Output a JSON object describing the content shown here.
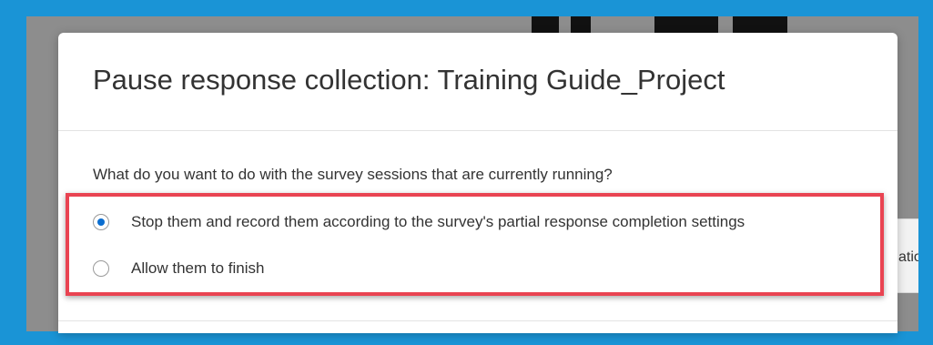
{
  "dialog": {
    "title": "Pause response collection: Training Guide_Project",
    "question": "What do you want to do with the survey sessions that are currently running?",
    "options": [
      {
        "label": "Stop them and record them according to the survey's partial response completion settings",
        "selected": true
      },
      {
        "label": "Allow them to finish",
        "selected": false
      }
    ]
  },
  "background": {
    "partial_text": "atio"
  },
  "colors": {
    "frame": "#1a94d6",
    "overlay": "#8d8d8d",
    "radio_selected": "#0b6ed0",
    "highlight": "#e94452"
  }
}
